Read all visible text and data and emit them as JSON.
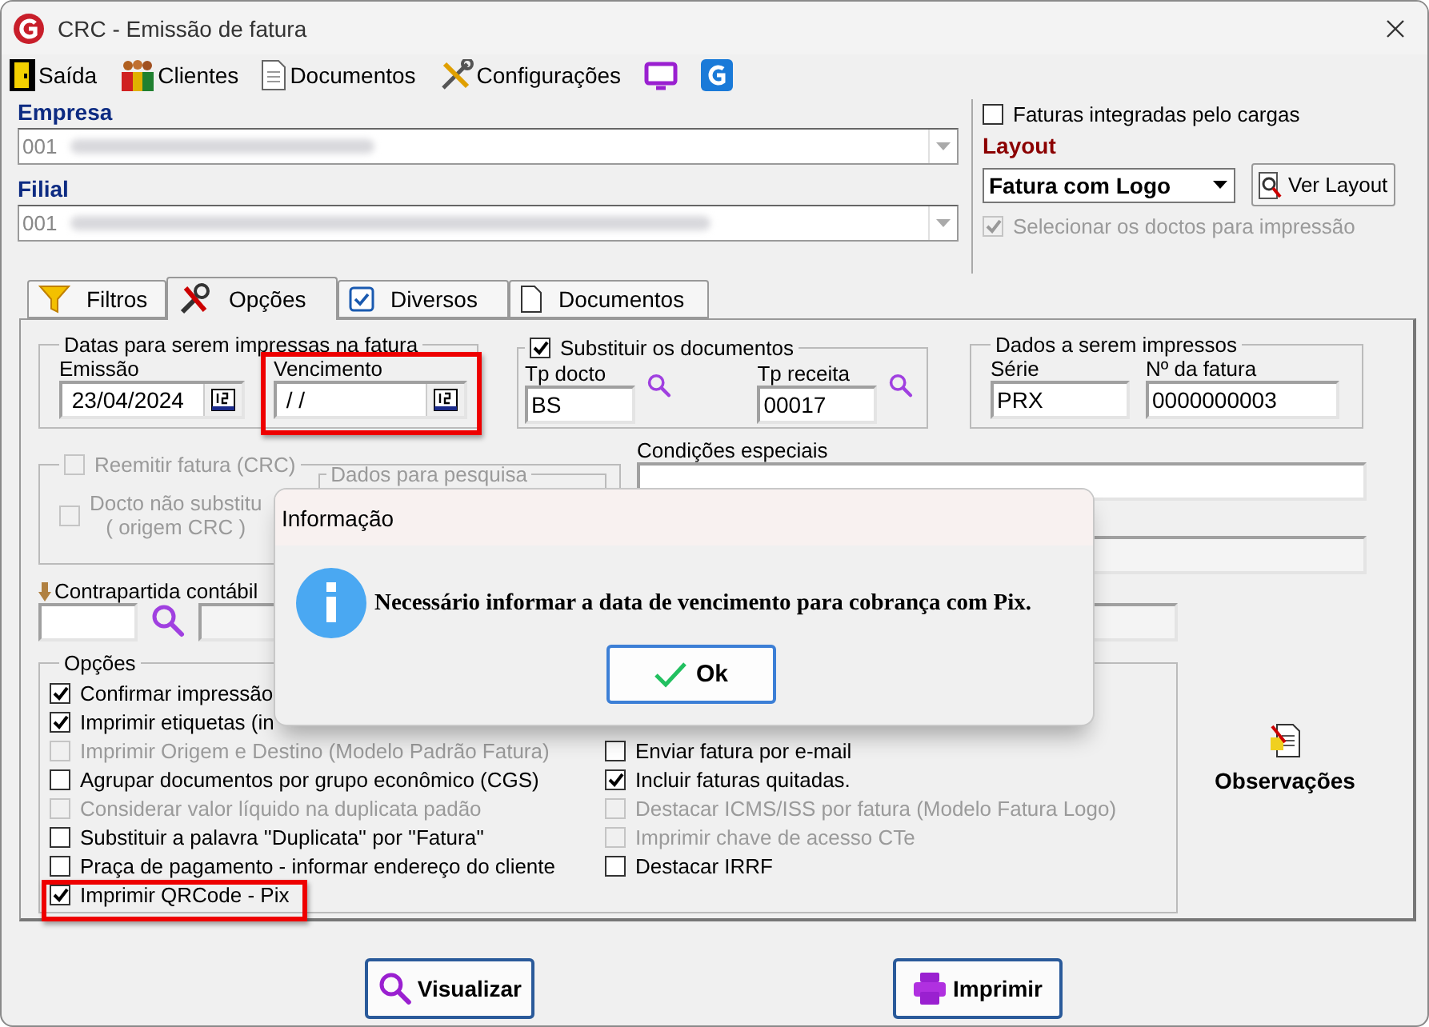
{
  "window": {
    "title": "CRC - Emissão de fatura"
  },
  "toolbar": [
    {
      "kind": "exit",
      "label": "Saída"
    },
    {
      "kind": "clients",
      "label": "Clientes"
    },
    {
      "kind": "documents",
      "label": "Documentos"
    },
    {
      "kind": "settings",
      "label": "Configurações"
    },
    {
      "kind": "monitor"
    },
    {
      "kind": "brand"
    }
  ],
  "empresa": {
    "label": "Empresa",
    "value": "001"
  },
  "filial": {
    "label": "Filial",
    "value": "001"
  },
  "integrated": {
    "label": "Faturas integradas pelo cargas",
    "checked": false
  },
  "layout": {
    "label": "Layout",
    "value": "Fatura com Logo",
    "button": "Ver Layout"
  },
  "select_docs": {
    "label": "Selecionar os doctos para impressão",
    "checked": true,
    "disabled": true
  },
  "tabs": [
    {
      "kind": "filter",
      "label": "Filtros",
      "selected": false
    },
    {
      "kind": "tools",
      "label": "Opções",
      "selected": true
    },
    {
      "kind": "check",
      "label": "Diversos",
      "selected": false
    },
    {
      "kind": "page",
      "label": "Documentos",
      "selected": false
    }
  ],
  "dates": {
    "title": "Datas para serem impressas na fatura",
    "emissao": {
      "label": "Emissão",
      "value": "23/04/2024"
    },
    "vencimento": {
      "label": "Vencimento",
      "value": "/ /",
      "highlighted": true
    }
  },
  "substituir": {
    "label": "Substituir os documentos",
    "checked": true,
    "tp_docto": {
      "label": "Tp docto",
      "value": "BS"
    },
    "tp_receita": {
      "label": "Tp receita",
      "value": "00017"
    }
  },
  "dados_impressos": {
    "title": "Dados a serem impressos",
    "serie": {
      "label": "Série",
      "value": "PRX"
    },
    "numero": {
      "label": "Nº da fatura",
      "value": "0000000003"
    }
  },
  "reemitir": {
    "label": "Reemitir fatura (CRC)",
    "checked": false,
    "disabled": true,
    "docto": {
      "label": "Docto não substitu",
      "sublabel": "( origem CRC )",
      "checked": false,
      "disabled": true
    },
    "pesquisa_title": "Dados para pesquisa"
  },
  "condicoes": {
    "label": "Condições especiais"
  },
  "contrapartida": {
    "label": "Contrapartida contábil"
  },
  "opcoes": {
    "title": "Opções",
    "left": [
      {
        "label": "Confirmar impressão",
        "checked": true,
        "disabled": false,
        "highlighted": false
      },
      {
        "label": "Imprimir etiquetas (in",
        "checked": true,
        "disabled": false,
        "highlighted": false
      },
      {
        "label": "Imprimir Origem e Destino (Modelo Padrão Fatura)",
        "checked": false,
        "disabled": true,
        "highlighted": false
      },
      {
        "label": "Agrupar documentos por grupo econômico (CGS)",
        "checked": false,
        "disabled": false,
        "highlighted": false
      },
      {
        "label": "Considerar valor líquido na duplicata padão",
        "checked": false,
        "disabled": true,
        "highlighted": false
      },
      {
        "label": "Substituir a palavra ''Duplicata'' por ''Fatura''",
        "checked": false,
        "disabled": false,
        "highlighted": false
      },
      {
        "label": "Praça de pagamento - informar endereço do cliente",
        "checked": false,
        "disabled": false,
        "highlighted": false
      },
      {
        "label": "Imprimir QRCode - Pix",
        "checked": true,
        "disabled": false,
        "highlighted": true
      }
    ],
    "right": [
      {
        "label": "Enviar fatura por e-mail",
        "checked": false,
        "disabled": false,
        "highlighted": false
      },
      {
        "label": "Incluir faturas quitadas.",
        "checked": true,
        "disabled": false,
        "highlighted": false
      },
      {
        "label": "Destacar ICMS/ISS por fatura (Modelo Fatura Logo)",
        "checked": false,
        "disabled": true,
        "highlighted": false
      },
      {
        "label": "Imprimir chave de acesso CTe",
        "checked": false,
        "disabled": true,
        "highlighted": false
      },
      {
        "label": "Destacar IRRF",
        "checked": false,
        "disabled": false,
        "highlighted": false
      }
    ]
  },
  "observacoes": {
    "label": "Observações"
  },
  "buttons": [
    {
      "kind": "preview",
      "label": "Visualizar"
    },
    {
      "kind": "print",
      "label": "Imprimir"
    }
  ],
  "dialog": {
    "title": "Informação",
    "message": "Necessário informar a data de vencimento para cobrança com Pix.",
    "button": "Ok"
  }
}
